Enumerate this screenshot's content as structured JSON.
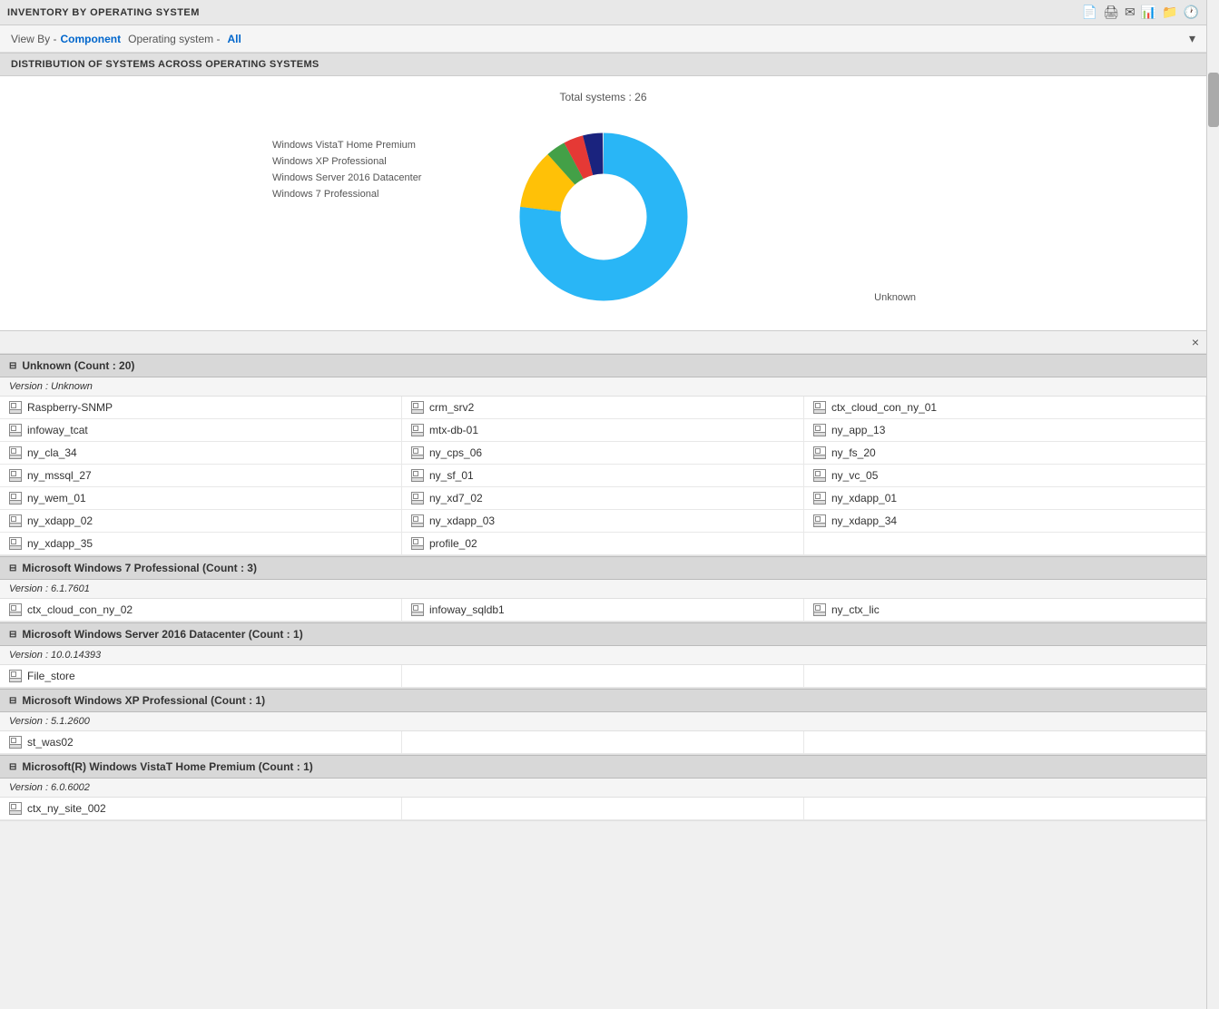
{
  "header": {
    "title": "INVENTORY BY OPERATING SYSTEM",
    "icons": [
      "pdf-icon",
      "print-icon",
      "email-icon",
      "excel-icon",
      "folder-icon",
      "clock-icon"
    ]
  },
  "filter": {
    "view_by_label": "View By -",
    "view_by_value": "Component",
    "separator": "Operating system -",
    "os_value": "All"
  },
  "distribution_section": {
    "title": "DISTRIBUTION OF SYSTEMS ACROSS OPERATING SYSTEMS"
  },
  "chart": {
    "total_label": "Total systems : 26",
    "legend": [
      {
        "label": "Windows VistaT Home Premium",
        "color": "#1a237e"
      },
      {
        "label": "Windows XP Professional",
        "color": "#e53935"
      },
      {
        "label": "Windows Server 2016 Datacenter",
        "color": "#43a047"
      },
      {
        "label": "Windows 7 Professional",
        "color": "#ffc107"
      }
    ],
    "unknown_label": "Unknown",
    "segments": [
      {
        "label": "Unknown",
        "color": "#29b6f6",
        "percent": 77
      },
      {
        "label": "Windows 7 Professional",
        "color": "#ffc107",
        "percent": 11.5
      },
      {
        "label": "Windows Server 2016 Datacenter",
        "color": "#43a047",
        "percent": 3.8
      },
      {
        "label": "Windows XP Professional",
        "color": "#e53935",
        "percent": 3.8
      },
      {
        "label": "Windows VistaT Home Premium",
        "color": "#1a237e",
        "percent": 3.8
      }
    ]
  },
  "groups": [
    {
      "title": "Unknown (Count : 20)",
      "collapsed": false,
      "version_label": "Version : Unknown",
      "items": [
        "Raspberry-SNMP",
        "crm_srv2",
        "ctx_cloud_con_ny_01",
        "infoway_tcat",
        "mtx-db-01",
        "ny_app_13",
        "ny_cla_34",
        "ny_cps_06",
        "ny_fs_20",
        "ny_mssql_27",
        "ny_sf_01",
        "ny_vc_05",
        "ny_wem_01",
        "ny_xd7_02",
        "ny_xdapp_01",
        "ny_xdapp_02",
        "ny_xdapp_03",
        "ny_xdapp_34",
        "ny_xdapp_35",
        "profile_02",
        ""
      ]
    },
    {
      "title": "Microsoft Windows 7 Professional (Count : 3)",
      "collapsed": false,
      "version_label": "Version : 6.1.7601",
      "items": [
        "ctx_cloud_con_ny_02",
        "infoway_sqldb1",
        "ny_ctx_lic"
      ]
    },
    {
      "title": "Microsoft Windows Server 2016 Datacenter (Count : 1)",
      "collapsed": false,
      "version_label": "Version : 10.0.14393",
      "items": [
        "File_store",
        "",
        ""
      ]
    },
    {
      "title": "Microsoft Windows XP Professional (Count : 1)",
      "collapsed": false,
      "version_label": "Version : 5.1.2600",
      "items": [
        "st_was02",
        "",
        ""
      ]
    },
    {
      "title": "Microsoft(R) Windows VistaT Home Premium (Count : 1)",
      "collapsed": false,
      "version_label": "Version : 6.0.6002",
      "items": [
        "ctx_ny_site_002",
        "",
        ""
      ]
    }
  ],
  "close_button": "×"
}
